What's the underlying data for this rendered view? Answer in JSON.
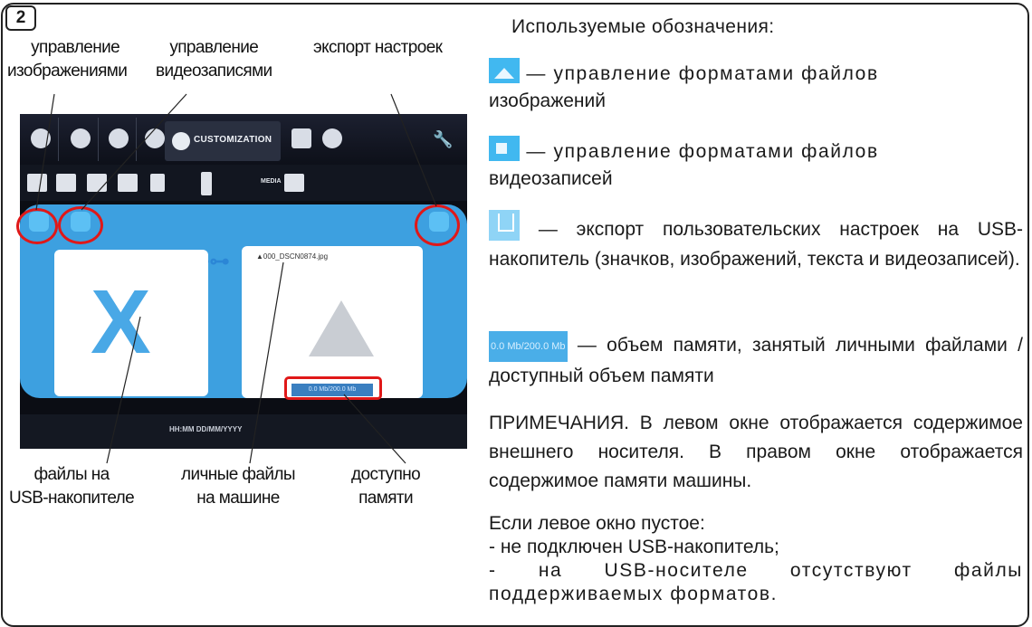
{
  "step_number": "2",
  "callouts": {
    "image_mgmt": [
      "управление",
      "изображениями"
    ],
    "video_mgmt": [
      "управление",
      "видеозаписями"
    ],
    "export_settings": "экспорт настроек",
    "usb_files": [
      "файлы на",
      "USB-накопителе"
    ],
    "personal_files": [
      "личные файлы",
      "на машине"
    ],
    "available_memory": [
      "доступно",
      "памяти"
    ]
  },
  "screenshot": {
    "customization_label": "CUSTOMIZATION",
    "media_label": "MEDIA",
    "file_name": "▲000_DSCN0874.jpg",
    "memory_readout": "0.0 Mb/200.0 Mb",
    "status_bar_text": "HH:MM DD/MM/YYYY"
  },
  "legend": {
    "title": "Используемые обозначения:",
    "images_text_1": " — управление форматами файлов",
    "images_text_2": "изображений",
    "video_text_1": " — управление форматами файлов",
    "video_text_2": "видеозаписей",
    "export_text": " — экспорт пользовательских настроек на USB-накопитель (значков, изображений, текста и видеозаписей).",
    "memory_badge": "0.0 Mb/200.0 Mb",
    "memory_text": " — объем памяти, занятый личными файлами / доступный объем памяти"
  },
  "notes": {
    "main": "ПРИМЕЧАНИЯ. В левом окне отображается содержимое внешнего носителя. В правом окне отображается содержимое памяти машины.",
    "empty_title": "Если левое окно пустое:",
    "empty_items": [
      "- не подключен USB-накопитель;",
      "- на USB-носителе отсутствуют файлы поддерживаемых форматов."
    ]
  }
}
